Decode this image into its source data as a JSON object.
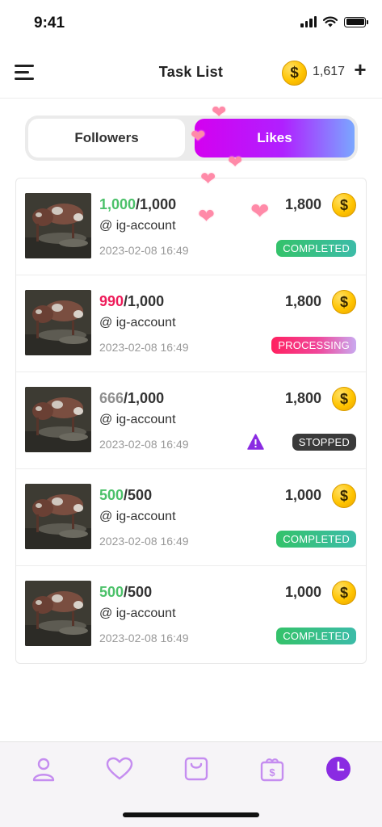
{
  "status_bar": {
    "time": "9:41"
  },
  "header": {
    "title": "Task List",
    "coin_balance": "1,617",
    "coin_symbol": "$",
    "add_symbol": "+"
  },
  "tabs": [
    {
      "label": "Followers",
      "active": false
    },
    {
      "label": "Likes",
      "active": true
    }
  ],
  "tasks": [
    {
      "done": "1,000",
      "total": "/1,000",
      "done_color": "#4cc16a",
      "account": "@ ig-account",
      "date": "2023-02-08 16:49",
      "price": "1,800",
      "status": "COMPLETED"
    },
    {
      "done": "990",
      "total": "/1,000",
      "done_color": "#ee1c5a",
      "account": "@ ig-account",
      "date": "2023-02-08 16:49",
      "price": "1,800",
      "status": "PROCESSING"
    },
    {
      "done": "666",
      "total": "/1,000",
      "done_color": "#8f8f8f",
      "account": "@ ig-account",
      "date": "2023-02-08 16:49",
      "price": "1,800",
      "status": "STOPPED"
    },
    {
      "done": "500",
      "total": "/500",
      "done_color": "#4cc16a",
      "account": "@ ig-account",
      "date": "2023-02-08 16:49",
      "price": "1,000",
      "status": "COMPLETED"
    },
    {
      "done": "500",
      "total": "/500",
      "done_color": "#4cc16a",
      "account": "@ ig-account",
      "date": "2023-02-08 16:49",
      "price": "1,000",
      "status": "COMPLETED"
    }
  ],
  "bottom_nav": [
    {
      "icon": "profile-icon",
      "active": false
    },
    {
      "icon": "heart-icon",
      "active": false
    },
    {
      "icon": "shop-bag-icon",
      "active": false
    },
    {
      "icon": "gift-coin-icon",
      "active": false
    },
    {
      "icon": "clock-icon",
      "active": true
    }
  ],
  "colors": {
    "accent": "#a855f7",
    "nav_icon": "#c58df0",
    "completed": "#34c26a",
    "processing": "#ff2160",
    "stopped": "#3a3a3a"
  }
}
